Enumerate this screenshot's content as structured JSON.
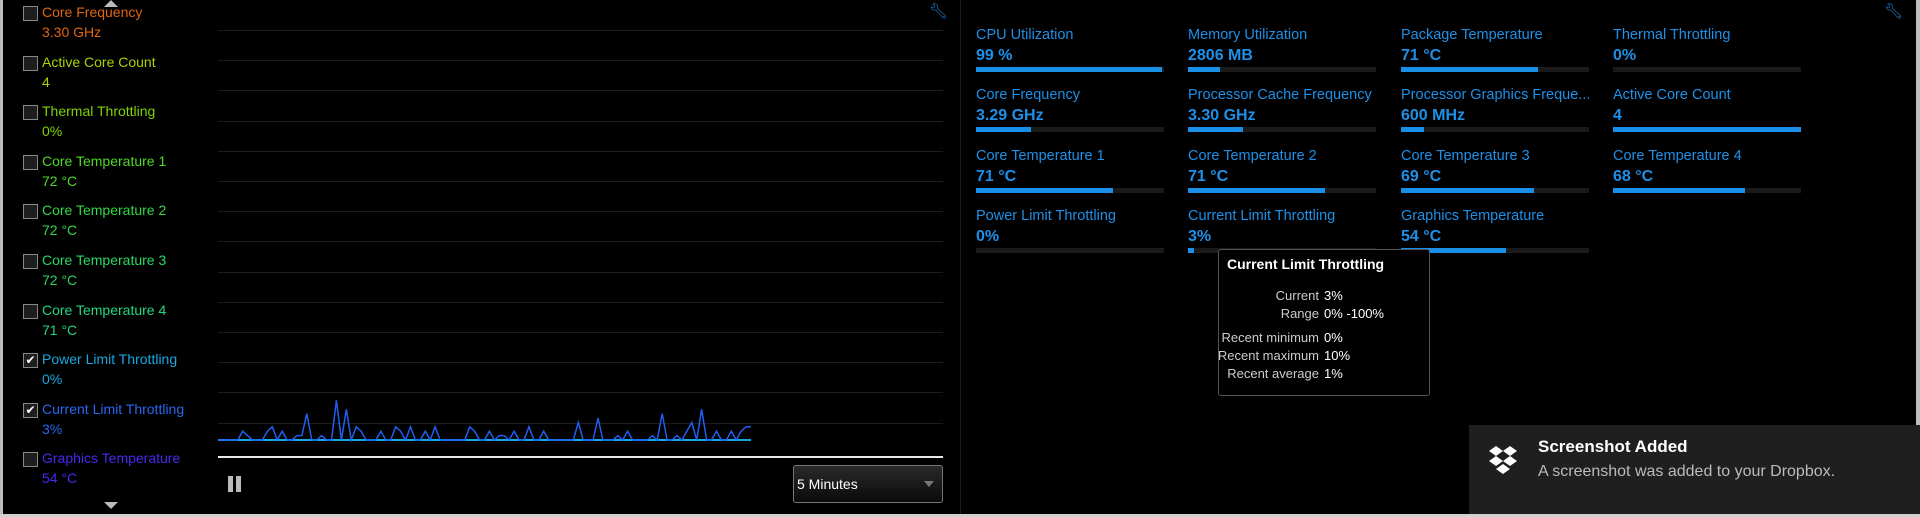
{
  "left_list": {
    "items": [
      {
        "label": "Core Frequency",
        "value": "3.30 GHz",
        "checked": false,
        "color": "#e0640f"
      },
      {
        "label": "Active Core Count",
        "value": "4",
        "checked": false,
        "color": "#a8d400"
      },
      {
        "label": "Thermal Throttling",
        "value": "0%",
        "checked": false,
        "color": "#80d400"
      },
      {
        "label": "Core Temperature 1",
        "value": "72 °C",
        "checked": false,
        "color": "#50d828"
      },
      {
        "label": "Core Temperature 2",
        "value": "72 °C",
        "checked": false,
        "color": "#30d848"
      },
      {
        "label": "Core Temperature 3",
        "value": "72 °C",
        "checked": false,
        "color": "#28d860"
      },
      {
        "label": "Core Temperature 4",
        "value": "71 °C",
        "checked": false,
        "color": "#20d880"
      },
      {
        "label": "Power Limit Throttling",
        "value": "0%",
        "checked": true,
        "color": "#18a8e0"
      },
      {
        "label": "Current Limit Throttling",
        "value": "3%",
        "checked": true,
        "color": "#2868f0"
      },
      {
        "label": "Graphics Temperature",
        "value": "54 °C",
        "checked": false,
        "color": "#4828f0"
      }
    ]
  },
  "graph": {
    "series": [
      {
        "name": "Current Limit Throttling",
        "color": "#1f5ff0",
        "values": [
          0,
          0,
          0,
          0,
          0,
          2,
          1,
          0,
          0,
          0,
          2,
          3,
          0,
          2,
          0,
          0,
          1,
          1,
          6,
          0,
          0,
          1,
          0,
          0,
          9,
          0,
          7,
          0,
          3,
          2,
          0,
          0,
          0,
          2,
          0,
          0,
          3,
          2,
          0,
          3,
          0,
          0,
          2,
          0,
          3,
          0,
          0,
          0,
          0,
          0,
          0,
          3,
          2,
          0,
          0,
          2,
          0,
          1,
          1,
          0,
          2,
          0,
          0,
          3,
          0,
          0,
          2,
          0,
          0,
          0,
          0,
          0,
          0,
          4,
          0,
          0,
          0,
          5,
          0,
          0,
          0,
          1,
          0,
          2,
          0,
          0,
          0,
          0,
          1,
          0,
          6,
          0,
          0,
          1,
          0,
          2,
          4,
          0,
          7,
          0,
          0,
          2,
          0,
          0,
          2,
          0,
          2,
          3,
          3
        ]
      },
      {
        "name": "Power Limit Throttling",
        "color": "#18a8e0",
        "values": [
          0,
          0
        ]
      }
    ]
  },
  "controls": {
    "pause_icon": "pause-icon",
    "time_range": "5 Minutes"
  },
  "metrics": [
    {
      "label": "CPU Utilization",
      "value": "99 %",
      "fill": 99
    },
    {
      "label": "Memory Utilization",
      "value": "2806  MB",
      "fill": 17
    },
    {
      "label": "Package Temperature",
      "value": "71 °C",
      "fill": 73
    },
    {
      "label": "Thermal Throttling",
      "value": "0%",
      "fill": 0
    },
    {
      "label": "Core Frequency",
      "value": "3.29 GHz",
      "fill": 29
    },
    {
      "label": "Processor Cache Frequency",
      "value": "3.30 GHz",
      "fill": 29
    },
    {
      "label": "Processor Graphics Freque...",
      "value": "600 MHz",
      "fill": 12
    },
    {
      "label": "Active Core Count",
      "value": "4",
      "fill": 100
    },
    {
      "label": "Core Temperature 1",
      "value": "71 °C",
      "fill": 73
    },
    {
      "label": "Core Temperature 2",
      "value": "71 °C",
      "fill": 73
    },
    {
      "label": "Core Temperature 3",
      "value": "69 °C",
      "fill": 71
    },
    {
      "label": "Core Temperature 4",
      "value": "68 °C",
      "fill": 70
    },
    {
      "label": "Power Limit Throttling",
      "value": "0%",
      "fill": 0
    },
    {
      "label": "Current Limit Throttling",
      "value": "3%",
      "fill": 3
    },
    {
      "label": "Graphics Temperature",
      "value": "54 °C",
      "fill": 56
    }
  ],
  "tooltip": {
    "title": "Current Limit Throttling",
    "rows": [
      {
        "k": "Current",
        "v": "3%"
      },
      {
        "k": "Range",
        "v": "0% -100%"
      },
      {
        "k": "Recent minimum",
        "v": "0%"
      },
      {
        "k": "Recent maximum",
        "v": "10%"
      },
      {
        "k": "Recent average",
        "v": "1%"
      }
    ]
  },
  "toast": {
    "title": "Screenshot Added",
    "body": "A screenshot was added to your Dropbox.",
    "icon": "dropbox-icon"
  },
  "colors": {
    "accent": "#1a8fe8",
    "toast_bg": "#1f1f1f"
  }
}
